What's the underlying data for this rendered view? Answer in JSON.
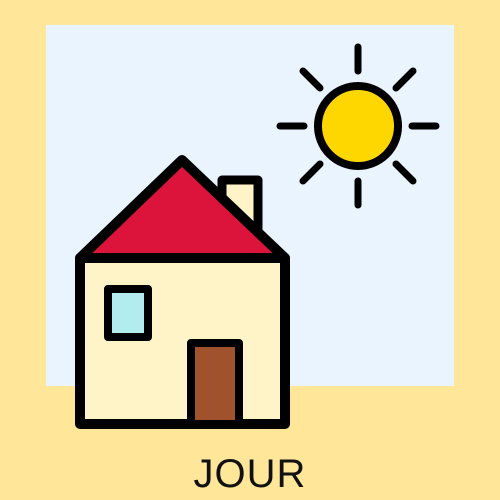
{
  "caption": "JOUR",
  "illustration": {
    "icons": [
      "sun-icon",
      "house-icon"
    ],
    "colors": {
      "page_background": "#FFE699",
      "sky": "#EAF4FF",
      "sun": "#FFD700",
      "roof": "#DC143C",
      "wall": "#FFF3C8",
      "window": "#B3ECEF",
      "door": "#A0522D",
      "outline": "#000000"
    }
  }
}
